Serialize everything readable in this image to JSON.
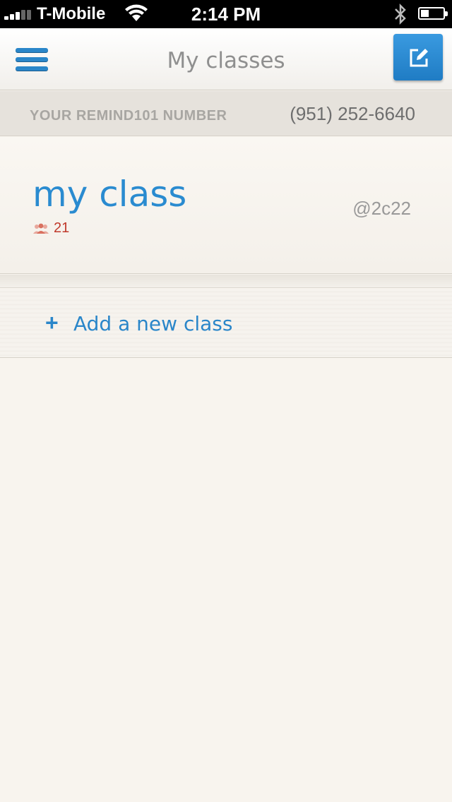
{
  "status_bar": {
    "carrier": "T-Mobile",
    "time": "2:14 PM",
    "battery_level": 0.35,
    "icons": [
      "signal-icon",
      "wifi-icon",
      "bluetooth-icon",
      "battery-icon"
    ]
  },
  "navbar": {
    "title": "My classes",
    "menu_icon": "hamburger-menu-icon",
    "compose_icon": "compose-icon",
    "accent_color": "#2a86c9"
  },
  "number_banner": {
    "label": "YOUR REMIND101 NUMBER",
    "value": "(951) 252-6640"
  },
  "classes": [
    {
      "name": "my class",
      "member_count": "21",
      "code": "@2c22",
      "members_icon": "people-icon"
    }
  ],
  "add_class": {
    "plus": "+",
    "label": "Add a new class"
  }
}
